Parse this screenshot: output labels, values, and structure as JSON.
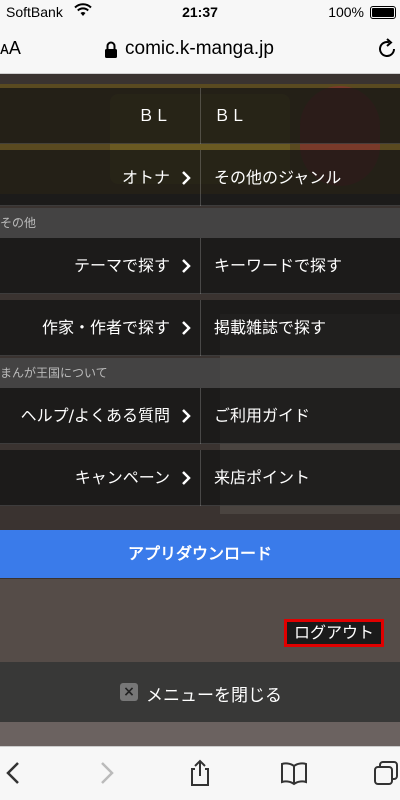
{
  "status_bar": {
    "carrier": "SoftBank",
    "time": "21:37",
    "battery": "100%"
  },
  "address_bar": {
    "text_size_label": "ᴀA",
    "url": "comic.k-manga.jp"
  },
  "menu": {
    "rows_top": [
      {
        "left": "ＢＬ",
        "right": "ＢＬ"
      },
      {
        "left": "オトナ",
        "right": "その他のジャンル"
      }
    ],
    "section_other": "その他",
    "rows_other": [
      {
        "left": "テーマで探す",
        "right": "キーワードで探す"
      },
      {
        "left": "作家・作者で探す",
        "right": "掲載雑誌で探す"
      }
    ],
    "section_about": "まんが王国について",
    "rows_about": [
      {
        "left": "ヘルプ/よくある質問",
        "right": "ご利用ガイド"
      },
      {
        "left": "キャンペーン",
        "right": "来店ポイント"
      }
    ],
    "app_download": "アプリダウンロード",
    "logout": "ログアウト",
    "close_menu": "メニューを閉じる"
  }
}
